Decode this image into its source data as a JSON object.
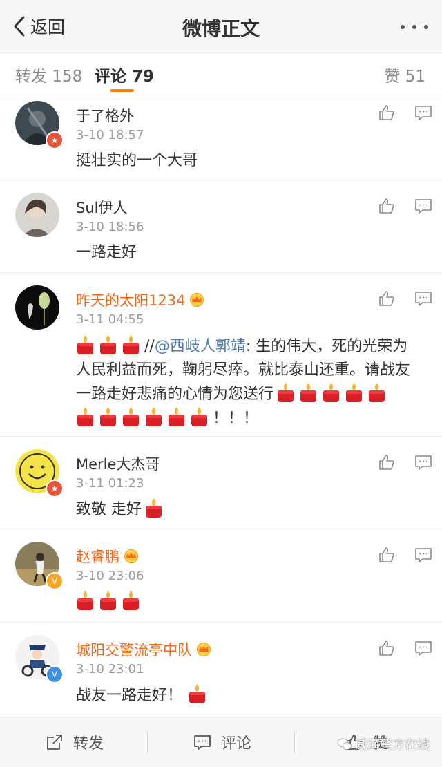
{
  "nav": {
    "back_label": "返回",
    "title": "微博正文"
  },
  "tabs": {
    "repost": "转发 158",
    "comment": "评论 79",
    "like": "赞 51"
  },
  "colors": {
    "accent": "#ff8200",
    "vip_name": "#f26a1b",
    "mention": "#4f7ab8"
  },
  "comments": [
    {
      "name": "于了格外",
      "time": "3-10 18:57",
      "text": "挺壮实的一个大哥",
      "badge": "red"
    },
    {
      "name": "Sul伊人",
      "time": "3-10 18:56",
      "text": "一路走好"
    },
    {
      "name": "昨天的太阳1234",
      "time": "3-11 04:55",
      "text_a": "//",
      "mention": "@西岐人郭靖",
      "text_b": ": 生的伟大，死的光荣为",
      "text_c": "人民利益而死，鞠躬尽瘁。就比泰山还重。请战友",
      "text_d": "一路走好悲痛的心情为您送行",
      "text_e": "！！！",
      "vip": true
    },
    {
      "name": "Merle大杰哥",
      "time": "3-11 01:23",
      "text": "致敬 走好",
      "badge": "red"
    },
    {
      "name": "赵睿鹏",
      "time": "3-10 23:06",
      "badge": "orange",
      "vip": true
    },
    {
      "name": "城阳交警流亭中队",
      "time": "3-10 23:01",
      "text": "战友一路走好！",
      "badge": "blue",
      "vip": true
    }
  ],
  "bottom": {
    "repost": "转发",
    "comment": "评论",
    "like": "赞",
    "watermark": "威海警方在线"
  }
}
